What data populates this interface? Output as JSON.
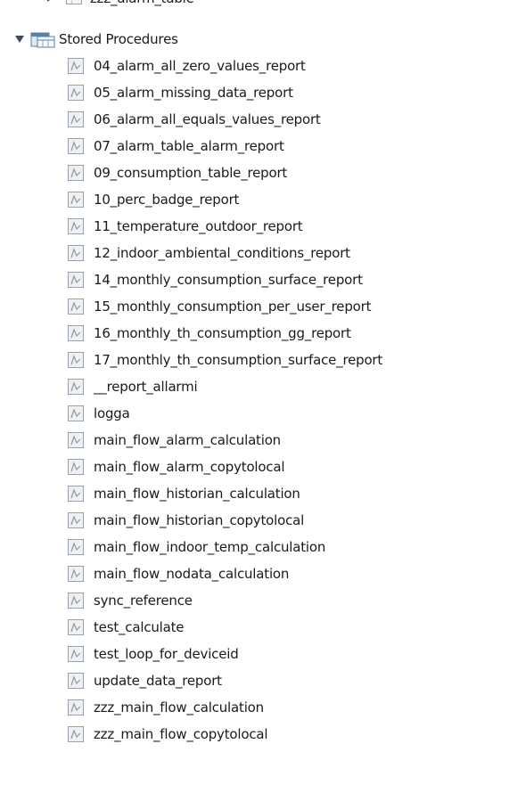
{
  "tree": {
    "cut_off_item": {
      "label": "zzz_alarm_table"
    },
    "stored_procedures_folder": {
      "label": "Stored Procedures",
      "expanded": true
    },
    "procedures": [
      "04_alarm_all_zero_values_report",
      "05_alarm_missing_data_report",
      "06_alarm_all_equals_values_report",
      "07_alarm_table_alarm_report",
      "09_consumption_table_report",
      "10_perc_badge_report",
      "11_temperature_outdoor_report",
      "12_indoor_ambiental_conditions_report",
      "14_monthly_consumption_surface_report",
      "15_monthly_consumption_per_user_report",
      "16_monthly_th_consumption_gg_report",
      "17_monthly_th_consumption_surface_report",
      "__report_allarmi",
      "logga",
      "main_flow_alarm_calculation",
      "main_flow_alarm_copytolocal",
      "main_flow_historian_calculation",
      "main_flow_historian_copytolocal",
      "main_flow_indoor_temp_calculation",
      "main_flow_nodata_calculation",
      "sync_reference",
      "test_calculate",
      "test_loop_for_deviceid",
      "update_data_report",
      "zzz_main_flow_calculation",
      "zzz_main_flow_copytolocal"
    ],
    "icons": {
      "procedure": "stored-procedure-icon",
      "folder": "stored-procedures-folder-icon",
      "table": "table-icon"
    },
    "colors": {
      "text": "#1a1a1a",
      "icon_border": "#9aa3ad",
      "icon_fill": "#eef1f4",
      "folder_blue": "#5b7fa6"
    }
  }
}
